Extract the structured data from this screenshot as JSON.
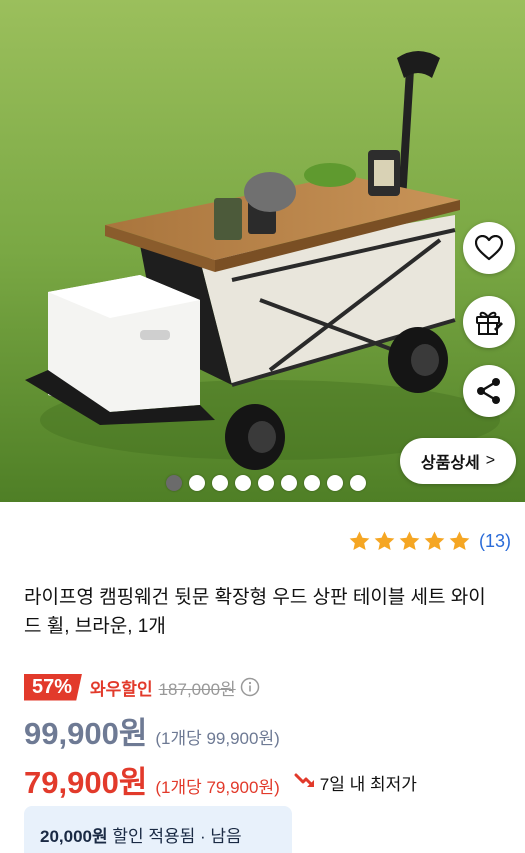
{
  "product": {
    "review_count": "(13)",
    "title": "라이프영 캠핑웨건 뒷문 확장형 우드 상판 테이블 세트 와이드 휠, 브라운, 1개",
    "rating_stars": 5
  },
  "gallery": {
    "dot_count": 9,
    "active_index": 0,
    "detail_button_label": "상품상세",
    "detail_button_chevron": ">"
  },
  "actions": {
    "heart_icon": "heart-icon",
    "gift_icon": "gift-icon",
    "share_icon": "share-icon"
  },
  "pricing": {
    "discount_badge": "57%",
    "wow_label": "와우할인",
    "original_price": "187,000원",
    "price_grey": "99,900원",
    "unit_grey": "(1개당 99,900원)",
    "price_red": "79,900원",
    "unit_red": "(1개당 79,900원)",
    "lowest_label": "7일 내 최저가"
  },
  "coupon": {
    "amount": "20,000원",
    "text": "할인 적용됨 · 남음"
  },
  "colors": {
    "accent_red": "#e23a2b",
    "star_orange": "#f5a623",
    "link_blue": "#2a6bd8",
    "grey_price": "#6e7a94"
  }
}
